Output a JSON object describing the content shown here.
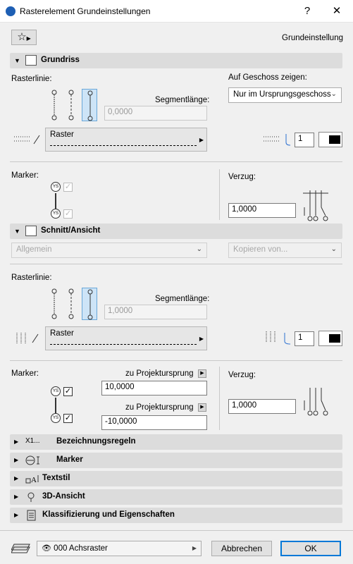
{
  "window": {
    "title": "Rasterelement Grundeinstellungen",
    "help": "?",
    "close": "✕"
  },
  "top": {
    "preset_label": "Grundeinstellung"
  },
  "grundriss": {
    "header": "Grundriss",
    "rasterlinie_label": "Rasterlinie:",
    "geschoss_label": "Auf Geschoss zeigen:",
    "geschoss_value": "Nur im Ursprungsgeschoss",
    "segment_label": "Segmentlänge:",
    "segment_value": "0,0000",
    "line_name": "Raster",
    "pen_value": "1",
    "marker_label": "Marker:",
    "verzug_label": "Verzug:",
    "verzug_value": "1,0000"
  },
  "schnitt": {
    "header": "Schnitt/Ansicht",
    "select_left": "Allgemein",
    "select_right": "Kopieren von...",
    "rasterlinie_label": "Rasterlinie:",
    "segment_label": "Segmentlänge:",
    "segment_value": "1,0000",
    "line_name": "Raster",
    "pen_value": "1",
    "marker_label": "Marker:",
    "proj1_label": "zu Projektursprung",
    "proj1_value": "10,0000",
    "proj2_label": "zu Projektursprung",
    "proj2_value": "-10,0000",
    "verzug_label": "Verzug:",
    "verzug_value": "1,0000"
  },
  "collapsed_sections": [
    {
      "label": "Bezeichnungsregeln",
      "icon": "X1..."
    },
    {
      "label": "Marker"
    },
    {
      "label": "Textstil"
    },
    {
      "label": "3D-Ansicht"
    },
    {
      "label": "Klassifizierung und Eigenschaften"
    }
  ],
  "footer": {
    "layer_value": "000 Achsraster",
    "cancel": "Abbrechen",
    "ok": "OK"
  }
}
